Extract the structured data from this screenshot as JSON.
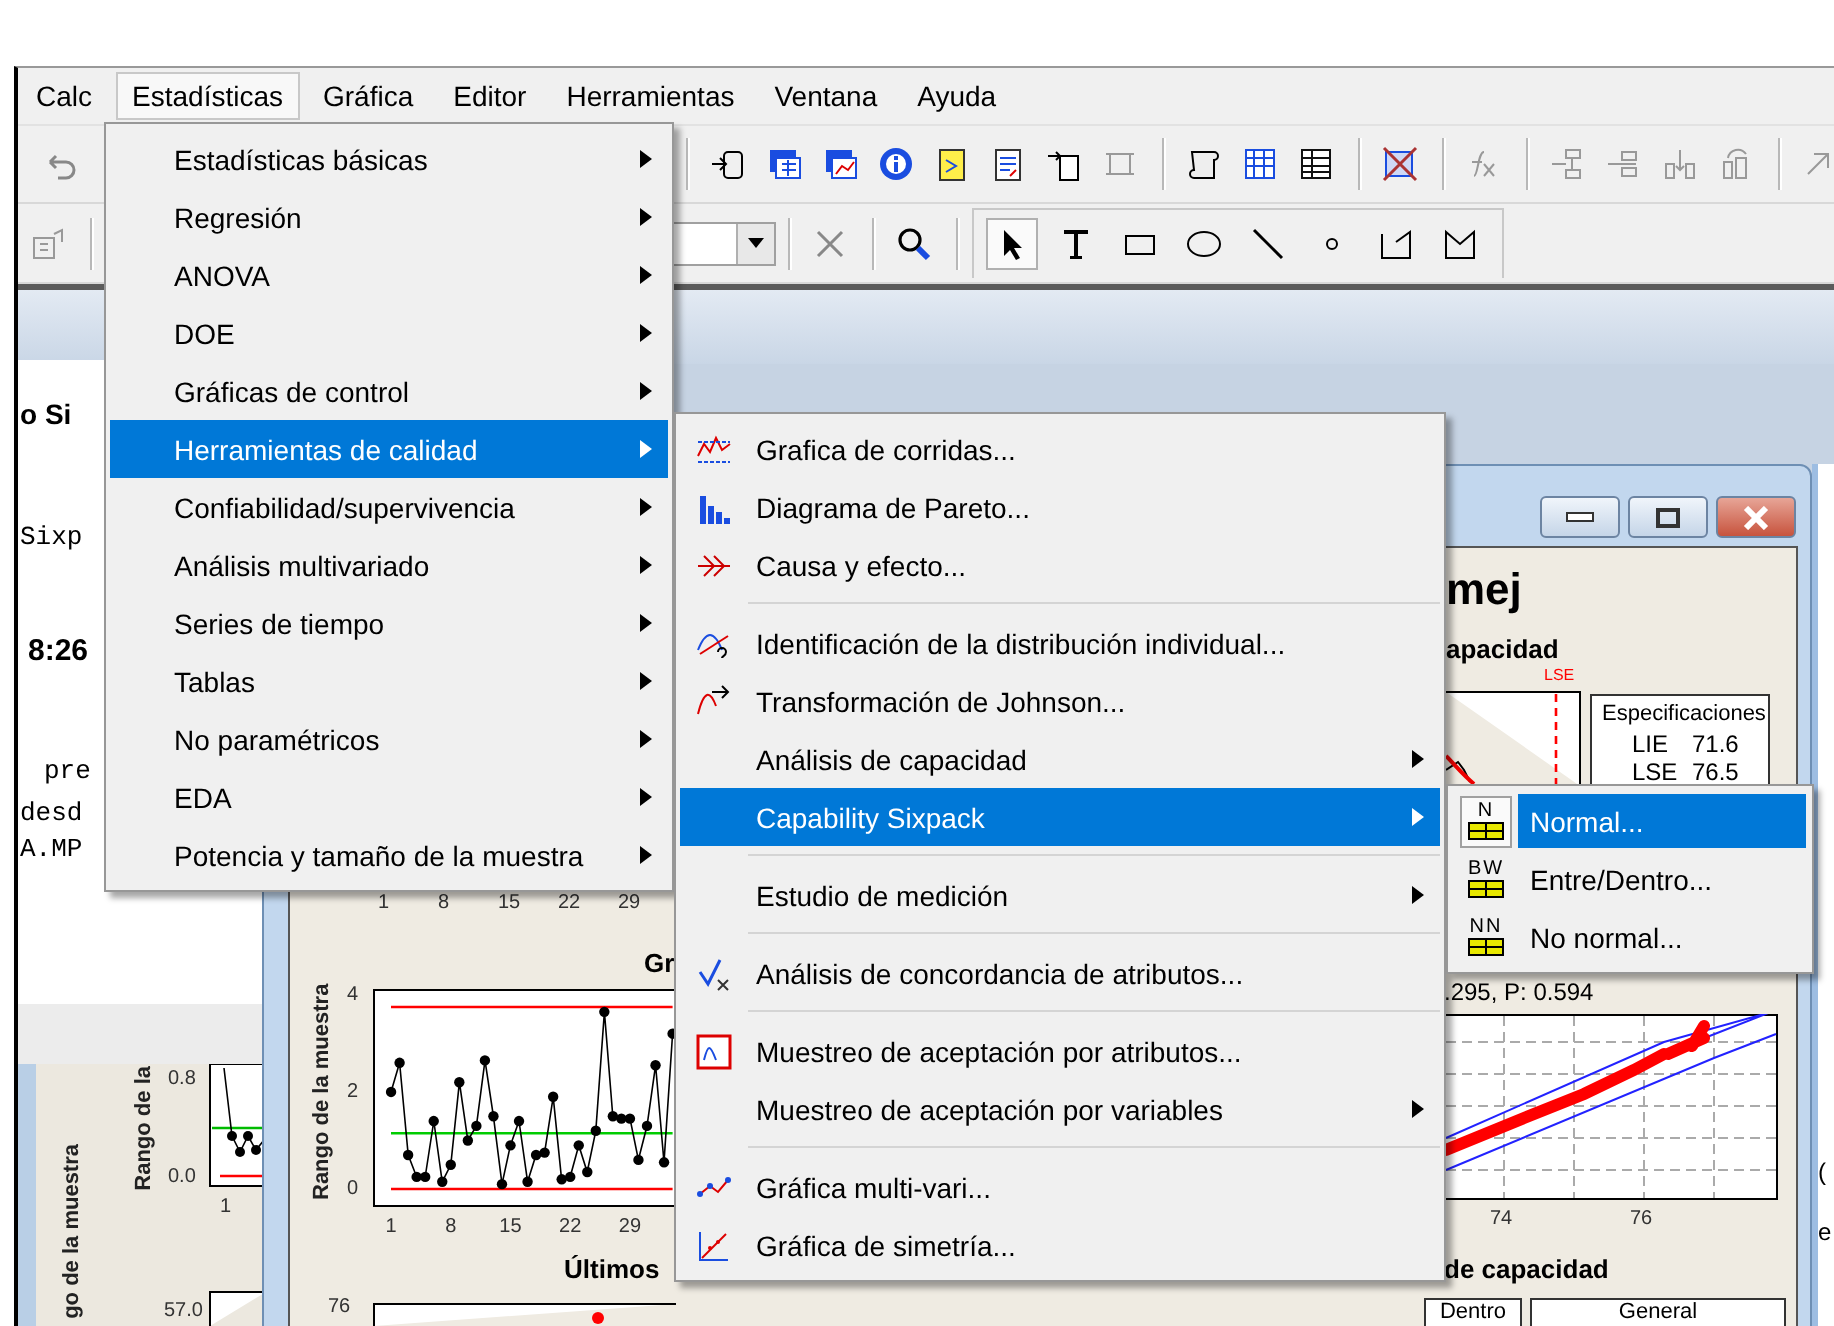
{
  "menu_bar": [
    {
      "label": "Calc",
      "selected": false
    },
    {
      "label": "Estadísticas",
      "selected": true
    },
    {
      "label": "Gráfica",
      "selected": false
    },
    {
      "label": "Editor",
      "selected": false
    },
    {
      "label": "Herramientas",
      "selected": false
    },
    {
      "label": "Ventana",
      "selected": false
    },
    {
      "label": "Ayuda",
      "selected": false
    }
  ],
  "session": {
    "lines": [
      {
        "text": "o Si",
        "kind": "heading"
      },
      {
        "text": "Sixp",
        "kind": "mono"
      },
      {
        "text": "8:26",
        "kind": "heading"
      },
      {
        "text": "pre",
        "kind": "mono"
      },
      {
        "text": "desd",
        "kind": "mono"
      },
      {
        "text": "A.MP",
        "kind": "mono"
      }
    ]
  },
  "back_window": {
    "outer_ylabel": "go de la muestra",
    "ylabel": "Rango de la",
    "yticks": [
      "0.8",
      "0.0"
    ],
    "xtick": "1",
    "lower_ytick": "57.0"
  },
  "graph_window": {
    "title": "mej",
    "subtitle": "apacidad",
    "histogram_label": "LSE",
    "specifications": {
      "title": "Especificaciones",
      "rows": [
        {
          "name": "LIE",
          "value": "71.6"
        },
        {
          "name": "LSE",
          "value": "76.5"
        }
      ]
    },
    "upper_xticks": [
      "1",
      "8",
      "15",
      "22",
      "29"
    ],
    "range_chart": {
      "chart_data": {
        "type": "line",
        "title": "Gr",
        "ylabel": "Rango de la muestra",
        "x": [
          1,
          2,
          3,
          4,
          5,
          6,
          7,
          8,
          9,
          10,
          11,
          12,
          13,
          14,
          15,
          16,
          17,
          18,
          19,
          20,
          21,
          22,
          23,
          24,
          25,
          26,
          27,
          28,
          29,
          30,
          31,
          32,
          33,
          34
        ],
        "series": [
          {
            "color": "#000000",
            "marker": "circle",
            "values": [
              2,
              2.6,
              0.7,
              0.25,
              0.25,
              1.4,
              0.15,
              0.5,
              2.2,
              1,
              1.3,
              2.65,
              1.5,
              0.1,
              0.9,
              1.4,
              0.15,
              0.7,
              0.75,
              1.9,
              0.2,
              0.25,
              0.9,
              0.35,
              1.2,
              3.65,
              1.5,
              1.45,
              1.45,
              0.6,
              1.3,
              2.55,
              0.55,
              3.2
            ]
          },
          {
            "color": "#ff0000",
            "values": [
              3.75,
              3.75,
              3.75,
              3.75,
              3.75,
              3.75,
              3.75,
              3.75,
              3.75,
              3.75,
              3.75,
              3.75,
              3.75,
              3.75,
              3.75,
              3.75,
              3.75,
              3.75,
              3.75,
              3.75,
              3.75,
              3.75,
              3.75,
              3.75,
              3.75,
              3.75,
              3.75,
              3.75,
              3.75,
              3.75,
              3.75,
              3.75,
              3.75,
              3.75
            ]
          },
          {
            "color": "#00cc00",
            "values": [
              1.15,
              1.15,
              1.15,
              1.15,
              1.15,
              1.15,
              1.15,
              1.15,
              1.15,
              1.15,
              1.15,
              1.15,
              1.15,
              1.15,
              1.15,
              1.15,
              1.15,
              1.15,
              1.15,
              1.15,
              1.15,
              1.15,
              1.15,
              1.15,
              1.15,
              1.15,
              1.15,
              1.15,
              1.15,
              1.15,
              1.15,
              1.15,
              1.15,
              1.15
            ]
          },
          {
            "color": "#ff0000",
            "values": [
              0,
              0,
              0,
              0,
              0,
              0,
              0,
              0,
              0,
              0,
              0,
              0,
              0,
              0,
              0,
              0,
              0,
              0,
              0,
              0,
              0,
              0,
              0,
              0,
              0,
              0,
              0,
              0,
              0,
              0,
              0,
              0,
              0,
              0
            ]
          }
        ],
        "yticks": [
          0,
          2,
          4
        ],
        "xticks": [
          1,
          8,
          15,
          22,
          29
        ],
        "xlim": [
          -1,
          34.4
        ],
        "ylim": [
          -0.35,
          4.1
        ]
      }
    },
    "bottom_chart": {
      "title": "Últimos",
      "ytick": "76"
    },
    "normal_plot": {
      "stat": ".295, P: 0.594",
      "xticks": [
        "74",
        "76"
      ]
    },
    "capability_title": "de capacidad",
    "capability_boxes": [
      "Dentro",
      "General"
    ]
  },
  "right_window": {
    "fragments": [
      "(",
      "e"
    ]
  },
  "main_menu": [
    {
      "label": "Estadísticas básicas",
      "submenu": true,
      "selected": false
    },
    {
      "label": "Regresión",
      "submenu": true,
      "selected": false
    },
    {
      "label": "ANOVA",
      "submenu": true,
      "selected": false
    },
    {
      "label": "DOE",
      "submenu": true,
      "selected": false
    },
    {
      "label": "Gráficas de control",
      "submenu": true,
      "selected": false
    },
    {
      "label": "Herramientas de calidad",
      "submenu": true,
      "selected": true
    },
    {
      "label": "Confiabilidad/supervivencia",
      "submenu": true,
      "selected": false
    },
    {
      "label": "Análisis multivariado",
      "submenu": true,
      "selected": false
    },
    {
      "label": "Series de tiempo",
      "submenu": true,
      "selected": false
    },
    {
      "label": "Tablas",
      "submenu": true,
      "selected": false
    },
    {
      "label": "No paramétricos",
      "submenu": true,
      "selected": false
    },
    {
      "label": "EDA",
      "submenu": true,
      "selected": false
    },
    {
      "label": "Potencia y tamaño de la muestra",
      "submenu": true,
      "selected": false
    }
  ],
  "quality_menu": [
    {
      "kind": "item",
      "label": "Grafica de corridas...",
      "submenu": false,
      "selected": false,
      "has_icon": true
    },
    {
      "kind": "item",
      "label": "Diagrama de Pareto...",
      "submenu": false,
      "selected": false,
      "has_icon": true
    },
    {
      "kind": "item",
      "label": "Causa y efecto...",
      "submenu": false,
      "selected": false,
      "has_icon": true
    },
    {
      "kind": "separator"
    },
    {
      "kind": "item",
      "label": "Identificación de la distribución individual...",
      "submenu": false,
      "selected": false,
      "has_icon": true
    },
    {
      "kind": "item",
      "label": "Transformación de Johnson...",
      "submenu": false,
      "selected": false,
      "has_icon": true
    },
    {
      "kind": "item",
      "label": "Análisis de capacidad",
      "submenu": true,
      "selected": false,
      "has_icon": false
    },
    {
      "kind": "item",
      "label": "Capability Sixpack",
      "submenu": true,
      "selected": true,
      "has_icon": false
    },
    {
      "kind": "separator"
    },
    {
      "kind": "item",
      "label": "Estudio de medición",
      "submenu": true,
      "selected": false,
      "has_icon": false
    },
    {
      "kind": "separator"
    },
    {
      "kind": "item",
      "label": "Análisis de concordancia de atributos...",
      "submenu": false,
      "selected": false,
      "has_icon": true
    },
    {
      "kind": "separator"
    },
    {
      "kind": "item",
      "label": "Muestreo de aceptación por atributos...",
      "submenu": false,
      "selected": false,
      "has_icon": true
    },
    {
      "kind": "item",
      "label": "Muestreo de aceptación por variables",
      "submenu": true,
      "selected": false,
      "has_icon": false
    },
    {
      "kind": "separator"
    },
    {
      "kind": "item",
      "label": "Gráfica multi-vari...",
      "submenu": false,
      "selected": false,
      "has_icon": true
    },
    {
      "kind": "item",
      "label": "Gráfica de simetría...",
      "submenu": false,
      "selected": false,
      "has_icon": true
    }
  ],
  "sixpack_menu": [
    {
      "label": "Normal...",
      "badge": "N",
      "selected": true
    },
    {
      "label": "Entre/Dentro...",
      "badge": "BW",
      "selected": false
    },
    {
      "label": "No normal...",
      "badge": "NN",
      "selected": false
    }
  ]
}
